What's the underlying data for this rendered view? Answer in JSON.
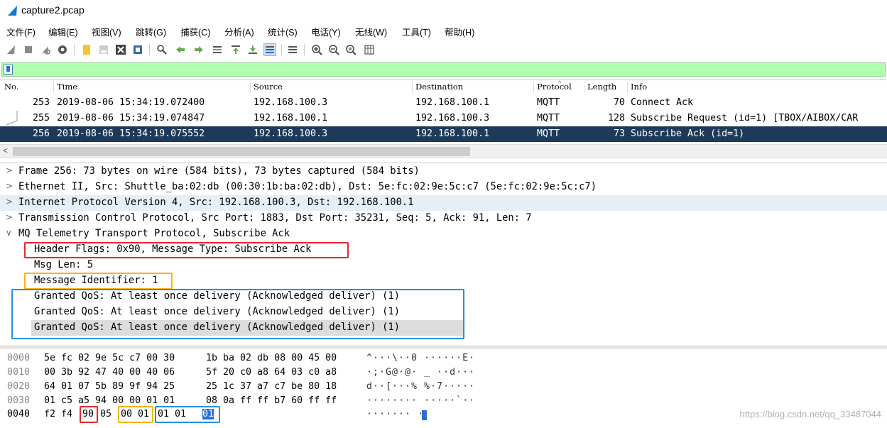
{
  "window": {
    "title": "capture2.pcap"
  },
  "menu": [
    "文件(F)",
    "编辑(E)",
    "视图(V)",
    "跳转(G)",
    "捕获(C)",
    "分析(A)",
    "统计(S)",
    "电话(Y)",
    "无线(W)",
    "工具(T)",
    "帮助(H)"
  ],
  "toolbar_icons": [
    "shark-fin-start-icon",
    "stop-icon",
    "restart-icon",
    "options-icon",
    "open-file-icon",
    "save-icon",
    "close-file-icon",
    "reload-icon",
    "find-icon",
    "back-icon",
    "forward-icon",
    "goto-packet-icon",
    "first-packet-icon",
    "last-packet-icon",
    "autoscroll-icon",
    "colorize-icon",
    "zoom-in-icon",
    "zoom-out-icon",
    "zoom-reset-icon",
    "resize-columns-icon"
  ],
  "colors": {
    "accent_selected": "#1d3a5a",
    "filter_bg": "#afffaf",
    "box_red": "#e8272c",
    "box_orange": "#f7b41a",
    "box_blue": "#2a8fe0"
  },
  "packet_list": {
    "headers": [
      "No.",
      "Time",
      "Source",
      "Destination",
      "Protocol",
      "Length",
      "Info"
    ],
    "rows": [
      [
        "253",
        "2019-08-06 15:34:19.072400",
        "192.168.100.3",
        "192.168.100.1",
        "MQTT",
        "70",
        "Connect Ack"
      ],
      [
        "255",
        "2019-08-06 15:34:19.074847",
        "192.168.100.1",
        "192.168.100.3",
        "MQTT",
        "128",
        "Subscribe Request (id=1) [TBOX/AIBOX/CAR"
      ],
      [
        "256",
        "2019-08-06 15:34:19.075552",
        "192.168.100.3",
        "192.168.100.1",
        "MQTT",
        "73",
        "Subscribe Ack (id=1)"
      ]
    ],
    "selected_index": 2
  },
  "detail": [
    {
      "arrow": ">",
      "text": "Frame 256: 73 bytes on wire (584 bits), 73 bytes captured (584 bits)"
    },
    {
      "arrow": ">",
      "text": "Ethernet II, Src: Shuttle_ba:02:db (00:30:1b:ba:02:db), Dst: 5e:fc:02:9e:5c:c7 (5e:fc:02:9e:5c:c7)"
    },
    {
      "arrow": ">",
      "text": "Internet Protocol Version 4, Src: 192.168.100.3, Dst: 192.168.100.1"
    },
    {
      "arrow": ">",
      "text": "Transmission Control Protocol, Src Port: 1883, Dst Port: 35231, Seq: 5, Ack: 91, Len: 7"
    },
    {
      "arrow": "v",
      "text": "MQ Telemetry Transport Protocol, Subscribe Ack"
    },
    {
      "arrow": "",
      "text": "Header Flags: 0x90, Message Type: Subscribe Ack"
    },
    {
      "arrow": "",
      "text": "Msg Len: 5"
    },
    {
      "arrow": "",
      "text": "Message Identifier: 1"
    },
    {
      "arrow": "",
      "text": "Granted QoS: At least once delivery (Acknowledged deliver) (1)"
    },
    {
      "arrow": "",
      "text": "Granted QoS: At least once delivery (Acknowledged deliver) (1)"
    },
    {
      "arrow": "",
      "text": "Granted QoS: At least once delivery (Acknowledged deliver) (1)"
    }
  ],
  "hex": [
    {
      "offset": "0000",
      "b1": "5e fc 02 9e 5c c7 00 30",
      "b2": "1b ba 02 db 08 00 45 00",
      "ascii": "^···\\··0 ······E·"
    },
    {
      "offset": "0010",
      "b1": "00 3b 92 47 40 00 40 06",
      "b2": "5f 20 c0 a8 64 03 c0 a8",
      "ascii": "·;·G@·@· _ ··d···"
    },
    {
      "offset": "0020",
      "b1": "64 01 07 5b 89 9f 94 25",
      "b2": "25 1c 37 a7 c7 be 80 18",
      "ascii": "d··[···% %·7·····"
    },
    {
      "offset": "0030",
      "b1": "01 c5 a5 94 00 00 01 01",
      "b2": "08 0a ff ff b7 60 ff ff",
      "ascii": "········ ·····`··"
    },
    {
      "offset": "0040",
      "b1_parts": [
        "f2 f4",
        "90",
        "05",
        "00 01",
        "01 01",
        "01"
      ],
      "ascii": "······· ·"
    }
  ],
  "watermark": "https://blog.csdn.net/qq_33487044"
}
